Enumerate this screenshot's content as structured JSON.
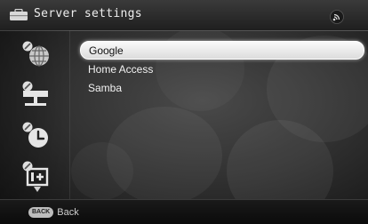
{
  "header": {
    "title": "Server settings",
    "icon": "briefcase-icon",
    "status_icon": "network-signal-icon"
  },
  "sidebar": {
    "icons": [
      "globe-settings-icon",
      "network-settings-icon",
      "clock-settings-icon",
      "info-settings-icon"
    ],
    "more_indicator": "down-arrow-icon"
  },
  "list": {
    "items": [
      {
        "label": "Google",
        "selected": true
      },
      {
        "label": "Home Access",
        "selected": false
      },
      {
        "label": "Samba",
        "selected": false
      }
    ]
  },
  "footer": {
    "back_key": "BACK",
    "back_label": "Back"
  },
  "colors": {
    "background": "#2e2e2e",
    "highlight": "#f5f5f5",
    "text": "#f2f2f2"
  }
}
